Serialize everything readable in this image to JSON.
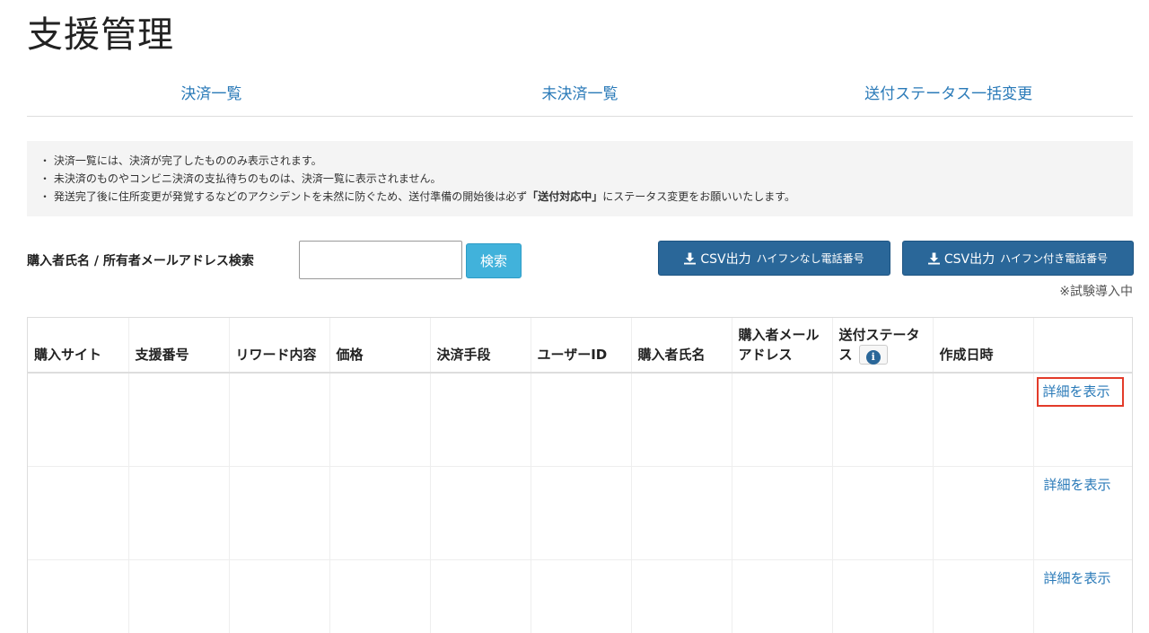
{
  "page": {
    "title": "支援管理"
  },
  "tabs": [
    {
      "label": "決済一覧"
    },
    {
      "label": "未決済一覧"
    },
    {
      "label": "送付ステータス一括変更"
    }
  ],
  "notice": {
    "line1": "・ 決済一覧には、決済が完了したもののみ表示されます。",
    "line2": "・ 未決済のものやコンビニ決済の支払待ちのものは、決済一覧に表示されません。",
    "line3_pre": "・ 発送完了後に住所変更が発覚するなどのアクシデントを未然に防ぐため、送付準備の開始後は必ず",
    "line3_bold": "「送付対応中」",
    "line3_post": "にステータス変更をお願いいたします。"
  },
  "search": {
    "label": "購入者氏名 / 所有者メールアドレス検索",
    "value": "",
    "button": "検索"
  },
  "csv": {
    "btn1_main": "CSV出力",
    "btn1_sub": "ハイフンなし電話番号",
    "btn2_main": "CSV出力",
    "btn2_sub": "ハイフン付き電話番号",
    "trial_note": "※試験導入中"
  },
  "table": {
    "headers": {
      "site": "購入サイト",
      "support_no": "支援番号",
      "reward": "リワード内容",
      "price": "価格",
      "payment": "決済手段",
      "user_id": "ユーザーID",
      "buyer_name": "購入者氏名",
      "buyer_email_1": "購入者メール",
      "buyer_email_2": "アドレス",
      "status_1": "送付ステータ",
      "status_2": "ス",
      "created": "作成日時",
      "info_glyph": "i"
    },
    "detail_link": "詳細を表示"
  },
  "icons": {
    "download": "download-icon",
    "info": "info-icon"
  },
  "colors": {
    "link": "#2a7ab8",
    "search_button": "#41b2db",
    "csv_button": "#2a6799",
    "highlight": "#e33b2a"
  }
}
